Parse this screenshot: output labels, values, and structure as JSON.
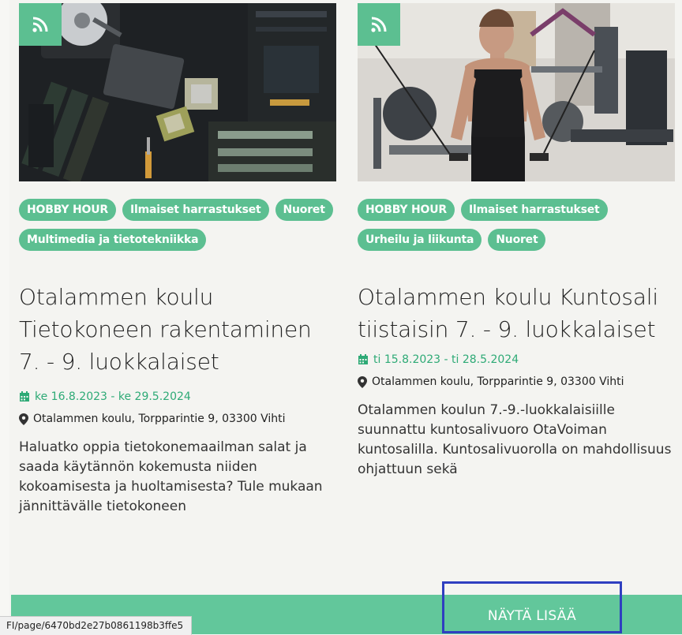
{
  "cards": [
    {
      "image_icon": "rss-icon",
      "tags": [
        "HOBBY HOUR",
        "Ilmaiset harrastukset",
        "Nuoret",
        "Multimedia ja tietotekniikka"
      ],
      "title": "Otalammen koulu Tietokoneen rakentaminen 7. - 9. luokkalaiset",
      "date": "ke 16.8.2023 - ke 29.5.2024",
      "location": "Otalammen koulu, Torpparintie 9, 03300 Vihti",
      "description": "Haluatko oppia tietokonemaailman salat ja saada käytännön kokemusta niiden kokoamisesta ja huoltamisesta? Tule mukaan jännittävälle tietokoneen"
    },
    {
      "image_icon": "rss-icon",
      "tags": [
        "HOBBY HOUR",
        "Ilmaiset harrastukset",
        "Urheilu ja liikunta",
        "Nuoret"
      ],
      "title": "Otalammen koulu Kuntosali tiistaisin 7. - 9. luokkalaiset",
      "date": "ti 15.8.2023 - ti 28.5.2024",
      "location": "Otalammen koulu, Torpparintie 9, 03300 Vihti",
      "description": "Otalammen koulun 7.-9.-luokkalaisiille suunnattu kuntosalivuoro OtaVoiman kuntosalilla. Kuntosalivuorolla on mahdollisuus ohjattuun sekä"
    }
  ],
  "more_button_label": "NÄYTÄ LISÄÄ",
  "status_url": "FI/page/6470bd2e27b0861198b3ffe5",
  "colors": {
    "accent": "#5cbf91",
    "date": "#2eaa76",
    "bar": "#62c79b",
    "focus": "#2f3fc0"
  }
}
